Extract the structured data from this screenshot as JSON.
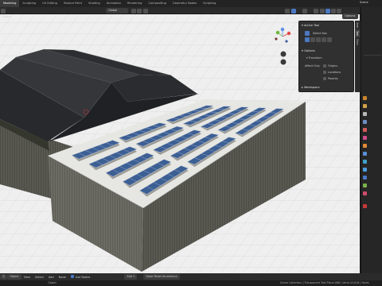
{
  "topbar": {
    "tabs": [
      "Modeling",
      "Sculpting",
      "UV Editing",
      "Texture Paint",
      "Shading",
      "Animation",
      "Rendering",
      "Compositing",
      "Geometry Nodes",
      "Scripting"
    ],
    "active_index": 0,
    "scene": "Scene"
  },
  "viewport_header": {
    "mode": "Object",
    "orientation": "Global",
    "options_label": "Options"
  },
  "sidebar_tabs": [
    "Item",
    "Tool",
    "View"
  ],
  "tool_panel": {
    "active_tool": "Active Tool",
    "select_box": "Select Box",
    "options": "Options",
    "transform": "Transform",
    "affect_only": "Affect Only",
    "origins": "Origins",
    "locations": "Locations",
    "parents": "Parents",
    "workspace": "Workspace"
  },
  "node_header": {
    "items": [
      "View",
      "Select",
      "Add",
      "Node"
    ],
    "use_nodes": "Use Nodes",
    "slot": "Slot 1",
    "material": "Solar Panel Aluminium"
  },
  "status": {
    "left": "Object",
    "right": "Scene Collection | Transparent Tool Plane.086 | Verts:43,816 | Faces"
  },
  "colors": {
    "accent": "#4a78c2",
    "roof": "#2f3033",
    "wall": "#5b5b53",
    "panel": "#3c5f94",
    "grid_bg": "#efefef"
  }
}
